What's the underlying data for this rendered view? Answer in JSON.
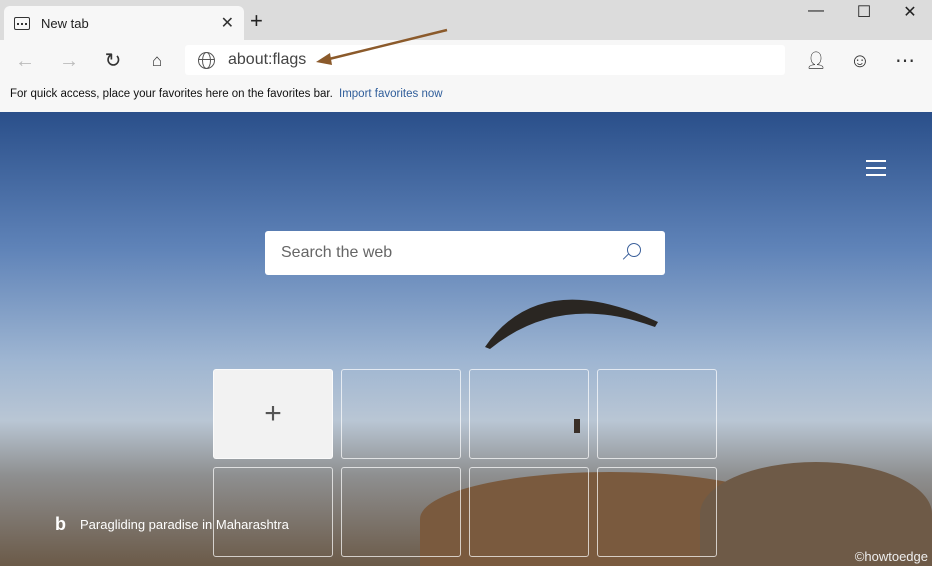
{
  "tab": {
    "title": "New tab",
    "icon": "newtab-page-icon"
  },
  "address": {
    "url": "about:flags"
  },
  "favorites_bar": {
    "text": "For quick access, place your favorites here on the favorites bar.",
    "link": "Import favorites now"
  },
  "search": {
    "placeholder": "Search the web"
  },
  "image_caption": "Paragliding paradise in Maharashtra",
  "watermark": "©howtoedge",
  "colors": {
    "arrow": "#8b5a2b",
    "link": "#2f5d9a"
  }
}
